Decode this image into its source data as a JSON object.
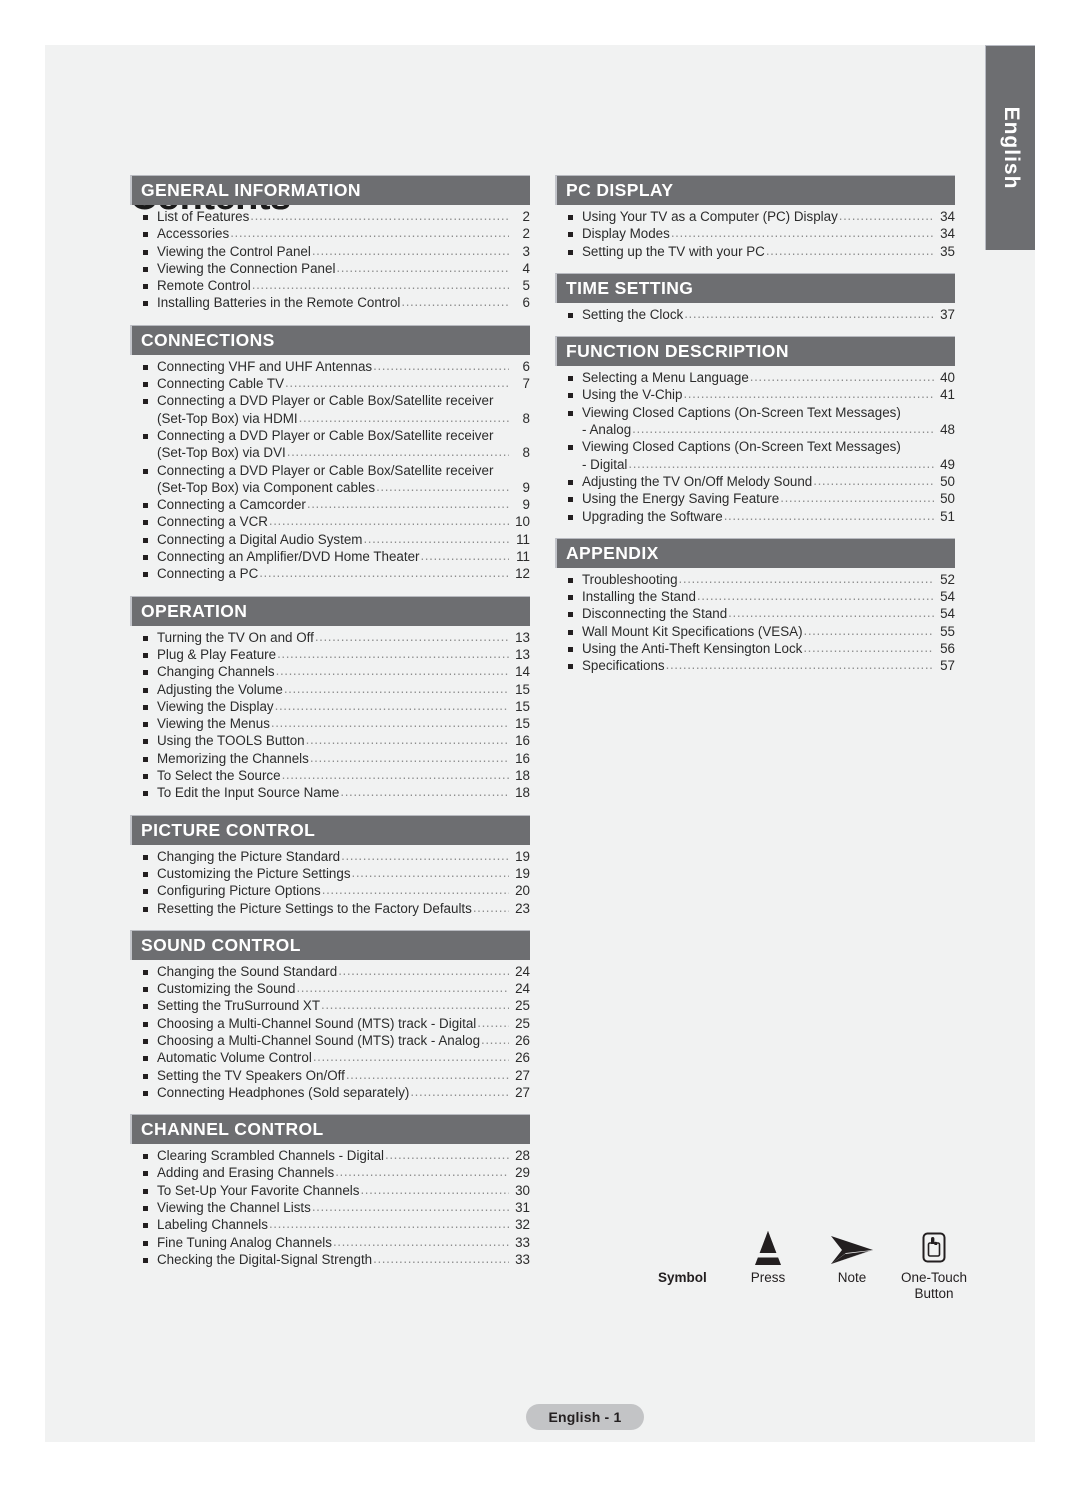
{
  "page": {
    "title": "Contents",
    "lang_tab": "English",
    "footer": "English - 1"
  },
  "left_column": [
    {
      "heading": "GENERAL INFORMATION",
      "items": [
        {
          "label": "List of Features",
          "page": "2"
        },
        {
          "label": "Accessories",
          "page": "2"
        },
        {
          "label": "Viewing the Control Panel",
          "page": "3"
        },
        {
          "label": "Viewing the Connection Panel",
          "page": "4"
        },
        {
          "label": "Remote Control",
          "page": "5"
        },
        {
          "label": "Installing Batteries in the Remote Control",
          "page": "6"
        }
      ]
    },
    {
      "heading": "CONNECTIONS",
      "items": [
        {
          "label": "Connecting VHF and UHF Antennas",
          "page": "6"
        },
        {
          "label": "Connecting Cable TV",
          "page": "7"
        },
        {
          "label": "Connecting a DVD Player or Cable Box/Satellite receiver",
          "page": "",
          "nodots": true
        },
        {
          "label": "(Set-Top Box) via HDMI",
          "page": "8",
          "cont": true
        },
        {
          "label": "Connecting a DVD Player or Cable Box/Satellite receiver",
          "page": "",
          "nodots": true
        },
        {
          "label": "(Set-Top Box) via DVI",
          "page": "8",
          "cont": true
        },
        {
          "label": "Connecting a DVD Player or Cable Box/Satellite receiver",
          "page": "",
          "nodots": true
        },
        {
          "label": "(Set-Top Box) via Component cables",
          "page": "9",
          "cont": true
        },
        {
          "label": "Connecting a Camcorder",
          "page": "9"
        },
        {
          "label": "Connecting a VCR",
          "page": "10"
        },
        {
          "label": "Connecting a Digital Audio System",
          "page": "11"
        },
        {
          "label": "Connecting an Amplifier/DVD Home Theater",
          "page": "11"
        },
        {
          "label": "Connecting a PC",
          "page": "12"
        }
      ]
    },
    {
      "heading": "OPERATION",
      "items": [
        {
          "label": "Turning the TV On and Off",
          "page": "13"
        },
        {
          "label": "Plug & Play Feature",
          "page": "13"
        },
        {
          "label": "Changing Channels",
          "page": "14"
        },
        {
          "label": "Adjusting the Volume",
          "page": "15"
        },
        {
          "label": "Viewing the Display",
          "page": "15"
        },
        {
          "label": "Viewing the Menus",
          "page": "15"
        },
        {
          "label": "Using the TOOLS Button",
          "page": "16"
        },
        {
          "label": "Memorizing the Channels",
          "page": "16"
        },
        {
          "label": "To Select the Source",
          "page": "18"
        },
        {
          "label": "To Edit the Input Source Name",
          "page": "18"
        }
      ]
    },
    {
      "heading": "PICTURE CONTROL",
      "items": [
        {
          "label": "Changing the Picture Standard",
          "page": "19"
        },
        {
          "label": "Customizing the Picture Settings",
          "page": "19"
        },
        {
          "label": "Configuring Picture Options",
          "page": "20"
        },
        {
          "label": "Resetting the Picture Settings to the Factory Defaults",
          "page": "23"
        }
      ]
    },
    {
      "heading": "SOUND CONTROL",
      "items": [
        {
          "label": "Changing the Sound Standard",
          "page": "24"
        },
        {
          "label": "Customizing the Sound",
          "page": "24"
        },
        {
          "label": "Setting the TruSurround XT",
          "page": "25"
        },
        {
          "label": "Choosing a Multi-Channel Sound (MTS) track - Digital",
          "page": "25"
        },
        {
          "label": "Choosing a Multi-Channel Sound (MTS) track - Analog",
          "page": "26"
        },
        {
          "label": "Automatic Volume Control",
          "page": "26"
        },
        {
          "label": "Setting the TV Speakers On/Off",
          "page": "27"
        },
        {
          "label": "Connecting Headphones (Sold separately)",
          "page": "27"
        }
      ]
    },
    {
      "heading": "CHANNEL CONTROL",
      "items": [
        {
          "label": "Clearing Scrambled Channels - Digital",
          "page": "28"
        },
        {
          "label": "Adding and Erasing Channels",
          "page": "29"
        },
        {
          "label": "To Set-Up Your Favorite Channels",
          "page": "30"
        },
        {
          "label": "Viewing the Channel Lists",
          "page": "31"
        },
        {
          "label": "Labeling Channels",
          "page": "32"
        },
        {
          "label": "Fine Tuning Analog Channels",
          "page": "33"
        },
        {
          "label": "Checking the Digital-Signal Strength",
          "page": "33"
        }
      ]
    }
  ],
  "right_column": [
    {
      "heading": "PC DISPLAY",
      "items": [
        {
          "label": "Using Your TV as a Computer (PC) Display",
          "page": "34"
        },
        {
          "label": "Display Modes",
          "page": "34"
        },
        {
          "label": "Setting up the TV with your PC",
          "page": "35"
        }
      ]
    },
    {
      "heading": "TIME SETTING",
      "items": [
        {
          "label": "Setting the Clock",
          "page": "37"
        }
      ]
    },
    {
      "heading": "FUNCTION DESCRIPTION",
      "items": [
        {
          "label": "Selecting a Menu Language",
          "page": "40"
        },
        {
          "label": "Using the V-Chip",
          "page": "41"
        },
        {
          "label": "Viewing Closed Captions (On-Screen Text Messages)",
          "page": "",
          "nodots": true
        },
        {
          "label": "- Analog",
          "page": "48",
          "cont": true
        },
        {
          "label": "Viewing Closed Captions (On-Screen Text Messages)",
          "page": "",
          "nodots": true
        },
        {
          "label": "- Digital",
          "page": "49",
          "cont": true
        },
        {
          "label": "Adjusting the TV On/Off Melody Sound",
          "page": "50"
        },
        {
          "label": "Using the Energy Saving Feature",
          "page": "50"
        },
        {
          "label": "Upgrading the Software",
          "page": "51"
        }
      ]
    },
    {
      "heading": "APPENDIX",
      "items": [
        {
          "label": "Troubleshooting",
          "page": "52"
        },
        {
          "label": "Installing the Stand",
          "page": "54"
        },
        {
          "label": "Disconnecting the Stand",
          "page": "54"
        },
        {
          "label": "Wall Mount Kit Specifications (VESA)",
          "page": "55"
        },
        {
          "label": "Using the Anti-Theft Kensington Lock",
          "page": "56"
        },
        {
          "label": "Specifications",
          "page": "57"
        }
      ]
    }
  ],
  "legend": {
    "title": "Symbol",
    "items": [
      {
        "icon": "press-triangle-icon",
        "caption": "Press"
      },
      {
        "icon": "note-arrow-icon",
        "caption": "Note"
      },
      {
        "icon": "one-touch-button-icon",
        "caption": "One-Touch\nButton"
      }
    ]
  },
  "colors": {
    "page_bg": "#f1f2f2",
    "header_bar": "#6d6e71",
    "header_text": "#ffffff",
    "body_text": "#2b2b2b",
    "footer_pill": "#c3c4c6"
  }
}
